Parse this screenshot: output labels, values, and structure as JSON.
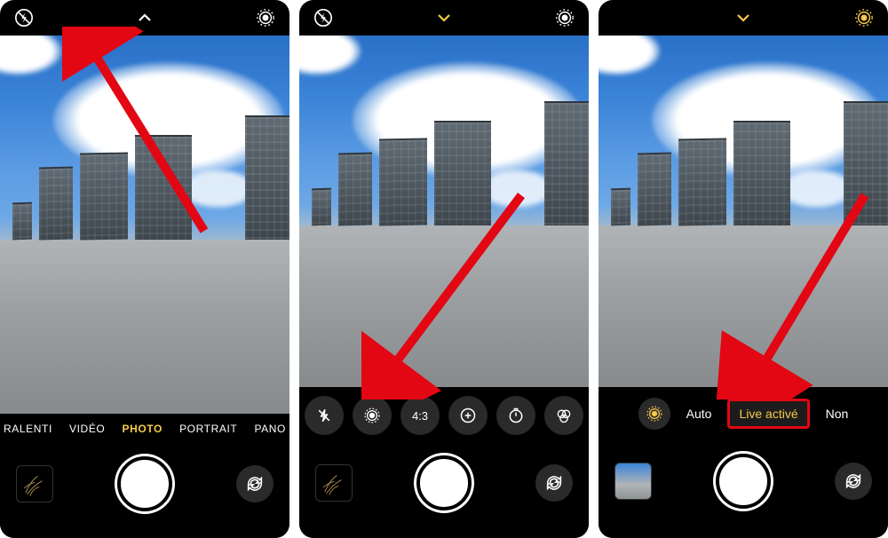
{
  "screen1": {
    "modes": [
      "RALENTI",
      "VIDÉO",
      "PHOTO",
      "PORTRAIT",
      "PANO"
    ],
    "active_mode_index": 2
  },
  "screen2": {
    "tools": {
      "ratio_label": "4:3"
    }
  },
  "screen3": {
    "options": {
      "auto": "Auto",
      "live_on": "Live activé",
      "off": "Non"
    }
  }
}
